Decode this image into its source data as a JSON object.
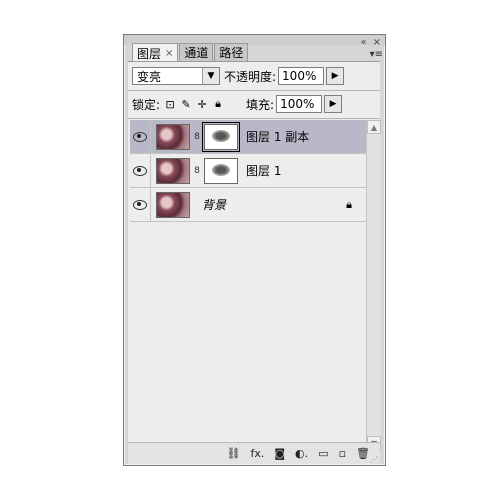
{
  "tabs": [
    {
      "label": "图层",
      "active": true,
      "close": "×"
    },
    {
      "label": "通道",
      "active": false
    },
    {
      "label": "路径",
      "active": false
    }
  ],
  "top_controls": {
    "minimize": "«",
    "close": "×",
    "menu": "▾≡"
  },
  "blend_mode": {
    "value": "变亮"
  },
  "opacity": {
    "label": "不透明度:",
    "value": "100%"
  },
  "lock": {
    "label": "锁定:"
  },
  "fill": {
    "label": "填充:",
    "value": "100%"
  },
  "layers": [
    {
      "name": "图层 1 副本",
      "selected": true,
      "visible": true
    },
    {
      "name": "图层 1",
      "selected": false,
      "visible": true
    },
    {
      "name": "背景",
      "selected": false,
      "visible": true,
      "locked": true,
      "italic": true
    }
  ],
  "bottom_icons": [
    "link-icon",
    "fx-icon",
    "mask-icon",
    "adjustment-icon",
    "folder-icon",
    "new-layer-icon",
    "trash-icon"
  ],
  "bottom_text": {
    "fx": "fx."
  }
}
